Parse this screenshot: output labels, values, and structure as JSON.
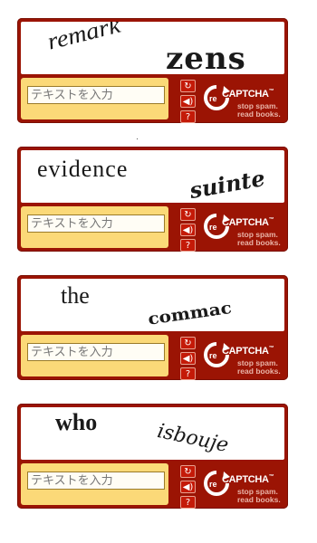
{
  "widgets": [
    {
      "word_left": "remark",
      "word_right": "zens"
    },
    {
      "word_left": "evidence",
      "word_right": "suinte"
    },
    {
      "word_left": "the",
      "word_right": "commac"
    },
    {
      "word_left": "who",
      "word_right": "isbouje"
    }
  ],
  "input": {
    "placeholder": "テキストを入力"
  },
  "controls": {
    "reload_icon": "refresh-icon",
    "audio_icon": "speaker-icon",
    "help_icon": "help-icon"
  },
  "brand": {
    "re": "re",
    "name": "CAPTCHA",
    "tm": "™",
    "tagline_1": "stop spam.",
    "tagline_2": "read books."
  },
  "colors": {
    "frame": "#9b1404",
    "input_panel": "#fbd978",
    "control_button": "#c41a08"
  }
}
